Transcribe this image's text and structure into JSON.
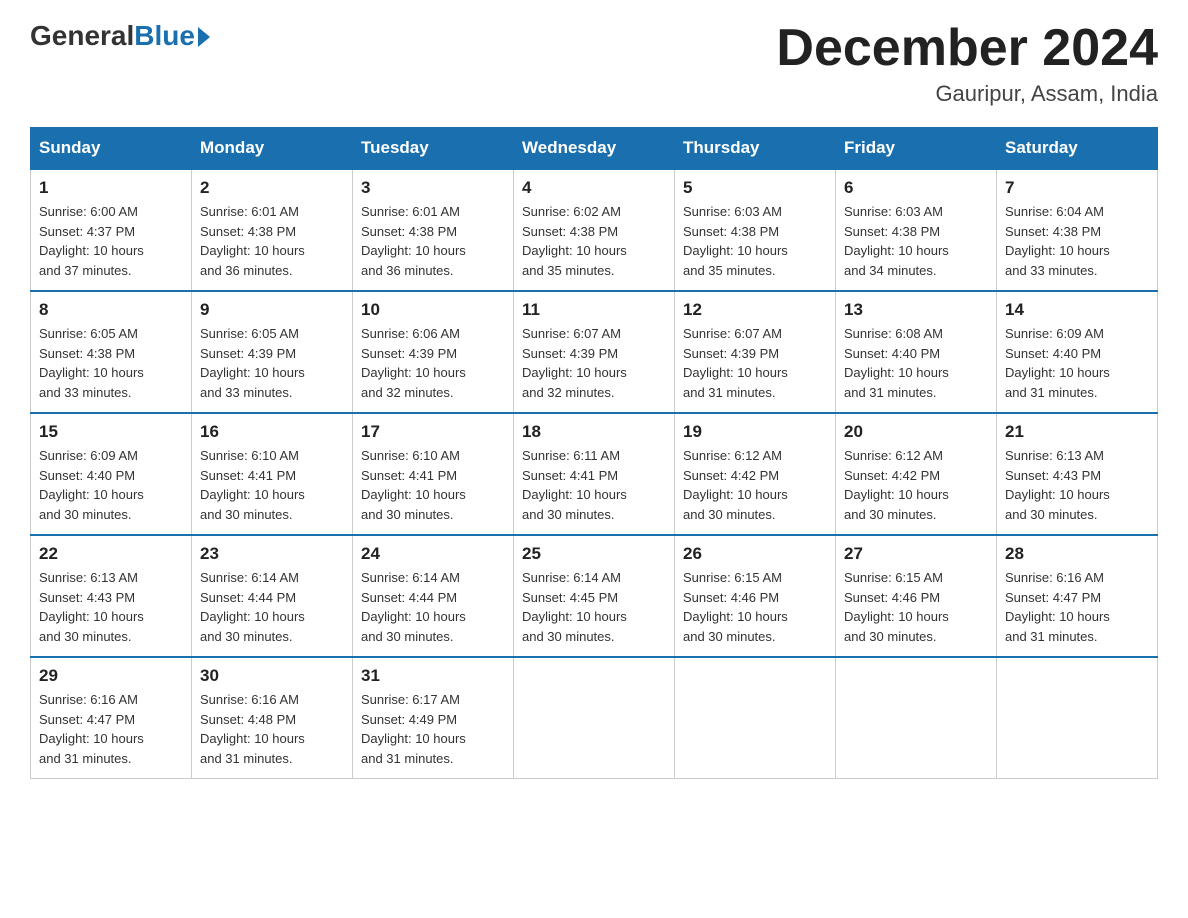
{
  "header": {
    "logo_general": "General",
    "logo_blue": "Blue",
    "month_title": "December 2024",
    "location": "Gauripur, Assam, India"
  },
  "days_of_week": [
    "Sunday",
    "Monday",
    "Tuesday",
    "Wednesday",
    "Thursday",
    "Friday",
    "Saturday"
  ],
  "weeks": [
    [
      {
        "day": "1",
        "info": "Sunrise: 6:00 AM\nSunset: 4:37 PM\nDaylight: 10 hours\nand 37 minutes."
      },
      {
        "day": "2",
        "info": "Sunrise: 6:01 AM\nSunset: 4:38 PM\nDaylight: 10 hours\nand 36 minutes."
      },
      {
        "day": "3",
        "info": "Sunrise: 6:01 AM\nSunset: 4:38 PM\nDaylight: 10 hours\nand 36 minutes."
      },
      {
        "day": "4",
        "info": "Sunrise: 6:02 AM\nSunset: 4:38 PM\nDaylight: 10 hours\nand 35 minutes."
      },
      {
        "day": "5",
        "info": "Sunrise: 6:03 AM\nSunset: 4:38 PM\nDaylight: 10 hours\nand 35 minutes."
      },
      {
        "day": "6",
        "info": "Sunrise: 6:03 AM\nSunset: 4:38 PM\nDaylight: 10 hours\nand 34 minutes."
      },
      {
        "day": "7",
        "info": "Sunrise: 6:04 AM\nSunset: 4:38 PM\nDaylight: 10 hours\nand 33 minutes."
      }
    ],
    [
      {
        "day": "8",
        "info": "Sunrise: 6:05 AM\nSunset: 4:38 PM\nDaylight: 10 hours\nand 33 minutes."
      },
      {
        "day": "9",
        "info": "Sunrise: 6:05 AM\nSunset: 4:39 PM\nDaylight: 10 hours\nand 33 minutes."
      },
      {
        "day": "10",
        "info": "Sunrise: 6:06 AM\nSunset: 4:39 PM\nDaylight: 10 hours\nand 32 minutes."
      },
      {
        "day": "11",
        "info": "Sunrise: 6:07 AM\nSunset: 4:39 PM\nDaylight: 10 hours\nand 32 minutes."
      },
      {
        "day": "12",
        "info": "Sunrise: 6:07 AM\nSunset: 4:39 PM\nDaylight: 10 hours\nand 31 minutes."
      },
      {
        "day": "13",
        "info": "Sunrise: 6:08 AM\nSunset: 4:40 PM\nDaylight: 10 hours\nand 31 minutes."
      },
      {
        "day": "14",
        "info": "Sunrise: 6:09 AM\nSunset: 4:40 PM\nDaylight: 10 hours\nand 31 minutes."
      }
    ],
    [
      {
        "day": "15",
        "info": "Sunrise: 6:09 AM\nSunset: 4:40 PM\nDaylight: 10 hours\nand 30 minutes."
      },
      {
        "day": "16",
        "info": "Sunrise: 6:10 AM\nSunset: 4:41 PM\nDaylight: 10 hours\nand 30 minutes."
      },
      {
        "day": "17",
        "info": "Sunrise: 6:10 AM\nSunset: 4:41 PM\nDaylight: 10 hours\nand 30 minutes."
      },
      {
        "day": "18",
        "info": "Sunrise: 6:11 AM\nSunset: 4:41 PM\nDaylight: 10 hours\nand 30 minutes."
      },
      {
        "day": "19",
        "info": "Sunrise: 6:12 AM\nSunset: 4:42 PM\nDaylight: 10 hours\nand 30 minutes."
      },
      {
        "day": "20",
        "info": "Sunrise: 6:12 AM\nSunset: 4:42 PM\nDaylight: 10 hours\nand 30 minutes."
      },
      {
        "day": "21",
        "info": "Sunrise: 6:13 AM\nSunset: 4:43 PM\nDaylight: 10 hours\nand 30 minutes."
      }
    ],
    [
      {
        "day": "22",
        "info": "Sunrise: 6:13 AM\nSunset: 4:43 PM\nDaylight: 10 hours\nand 30 minutes."
      },
      {
        "day": "23",
        "info": "Sunrise: 6:14 AM\nSunset: 4:44 PM\nDaylight: 10 hours\nand 30 minutes."
      },
      {
        "day": "24",
        "info": "Sunrise: 6:14 AM\nSunset: 4:44 PM\nDaylight: 10 hours\nand 30 minutes."
      },
      {
        "day": "25",
        "info": "Sunrise: 6:14 AM\nSunset: 4:45 PM\nDaylight: 10 hours\nand 30 minutes."
      },
      {
        "day": "26",
        "info": "Sunrise: 6:15 AM\nSunset: 4:46 PM\nDaylight: 10 hours\nand 30 minutes."
      },
      {
        "day": "27",
        "info": "Sunrise: 6:15 AM\nSunset: 4:46 PM\nDaylight: 10 hours\nand 30 minutes."
      },
      {
        "day": "28",
        "info": "Sunrise: 6:16 AM\nSunset: 4:47 PM\nDaylight: 10 hours\nand 31 minutes."
      }
    ],
    [
      {
        "day": "29",
        "info": "Sunrise: 6:16 AM\nSunset: 4:47 PM\nDaylight: 10 hours\nand 31 minutes."
      },
      {
        "day": "30",
        "info": "Sunrise: 6:16 AM\nSunset: 4:48 PM\nDaylight: 10 hours\nand 31 minutes."
      },
      {
        "day": "31",
        "info": "Sunrise: 6:17 AM\nSunset: 4:49 PM\nDaylight: 10 hours\nand 31 minutes."
      },
      {
        "day": "",
        "info": ""
      },
      {
        "day": "",
        "info": ""
      },
      {
        "day": "",
        "info": ""
      },
      {
        "day": "",
        "info": ""
      }
    ]
  ]
}
